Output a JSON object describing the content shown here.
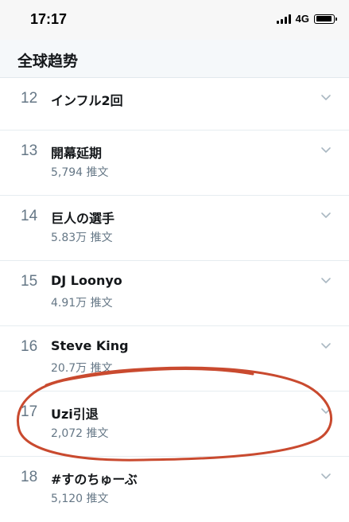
{
  "status_bar": {
    "time": "17:17",
    "network": "4G"
  },
  "header": {
    "title": "全球趋势"
  },
  "trends": [
    {
      "rank": "12",
      "name": "インフル2回",
      "count": ""
    },
    {
      "rank": "13",
      "name": "開幕延期",
      "count": "5,794 推文"
    },
    {
      "rank": "14",
      "name": "巨人の選手",
      "count": "5.83万 推文"
    },
    {
      "rank": "15",
      "name": "DJ Loonyo",
      "count": "4.91万 推文"
    },
    {
      "rank": "16",
      "name": "Steve King",
      "count": "20.7万 推文"
    },
    {
      "rank": "17",
      "name": "Uzi引退",
      "count": "2,072 推文"
    },
    {
      "rank": "18",
      "name": "#すのちゅーぶ",
      "count": "5,120 推文"
    }
  ],
  "icons": {
    "signal": "signal-icon",
    "battery": "battery-icon",
    "chevron": "chevron-down-icon"
  },
  "colors": {
    "annotation_circle": "#c94a2f",
    "secondary_text": "#657786",
    "primary_text": "#14171a"
  },
  "highlighted_trend_rank": "17"
}
